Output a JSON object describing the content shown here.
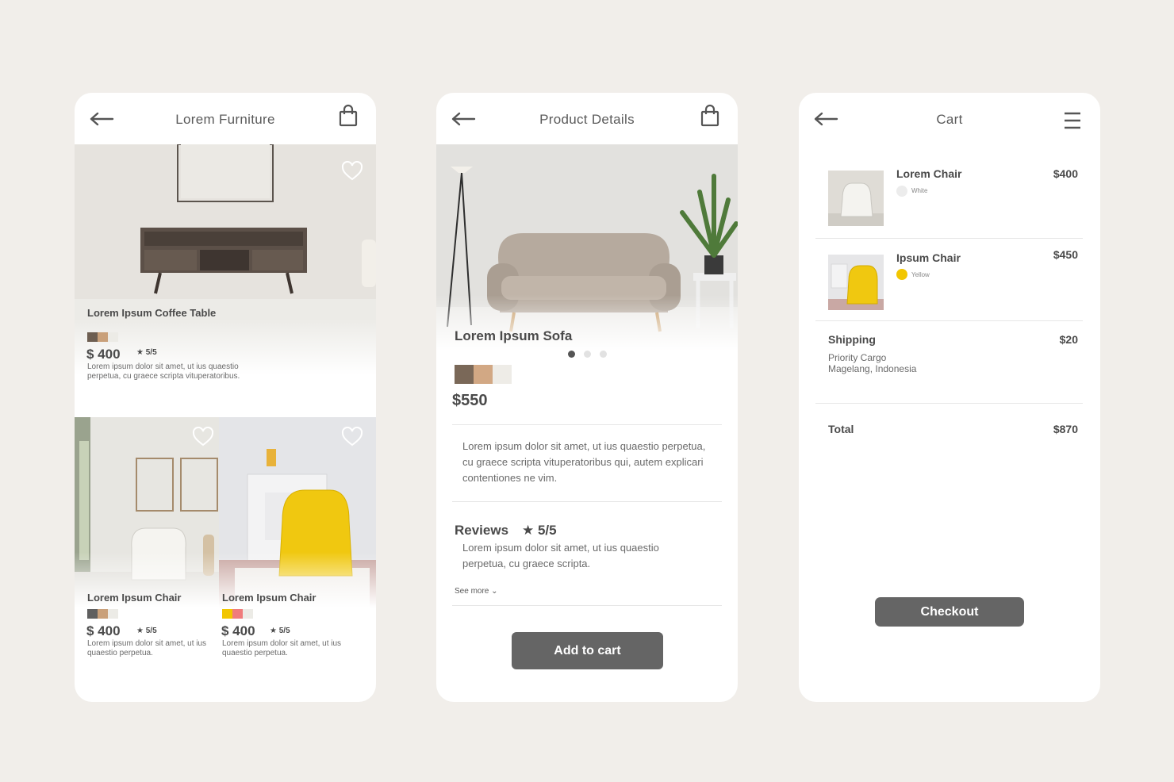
{
  "screen1": {
    "title": "Lorem Furniture",
    "featured": {
      "name": "Lorem Ipsum Coffee Table",
      "swatches": [
        "#6d5e51",
        "#c9a07a",
        "#ecebe6"
      ],
      "price": "$ 400",
      "rating": "★ 5/5",
      "description": "Lorem ipsum dolor sit amet, ut ius quaestio perpetua, cu graece scripta vituperatoribus."
    },
    "products": [
      {
        "name": "Lorem Ipsum Chair",
        "swatches": [
          "#5f5f5f",
          "#c9a07a",
          "#ecebe6"
        ],
        "price": "$ 400",
        "rating": "★ 5/5",
        "description": "Lorem ipsum dolor sit amet, ut ius quaestio perpetua."
      },
      {
        "name": "Lorem Ipsum Chair",
        "swatches": [
          "#f2c600",
          "#f07c7c",
          "#ecebe6"
        ],
        "price": "$ 400",
        "rating": "★ 5/5",
        "description": "Lorem ipsum dolor sit amet, ut ius quaestio perpetua."
      }
    ]
  },
  "screen2": {
    "title": "Product Details",
    "product_name": "Lorem Ipsum Sofa",
    "swatches": [
      "#7a6858",
      "#d2a884",
      "#eeece7"
    ],
    "price": "$550",
    "description": "Lorem ipsum dolor sit amet, ut ius quaestio perpetua, cu graece scripta vituperatoribus qui, autem explicari contentiones ne vim.",
    "reviews_heading": "Reviews",
    "reviews_rating": "★ 5/5",
    "review_text": "Lorem ipsum dolor sit amet, ut ius quaestio perpetua, cu graece scripta.",
    "see_more": "See more ⌄",
    "add_to_cart": "Add to cart",
    "carousel_active_index": 0
  },
  "screen3": {
    "title": "Cart",
    "items": [
      {
        "name": "Lorem Chair",
        "color_label": "White",
        "color": "#ececec",
        "price": "$400"
      },
      {
        "name": "Ipsum Chair",
        "color_label": "Yellow",
        "color": "#f2c600",
        "price": "$450"
      }
    ],
    "shipping_label": "Shipping",
    "shipping_method": "Priority Cargo",
    "shipping_location": "Magelang, Indonesia",
    "shipping_price": "$20",
    "total_label": "Total",
    "total_price": "$870",
    "checkout": "Checkout"
  },
  "colors": {
    "background": "#f1eeea",
    "button": "#656565",
    "text": "#4a4a4a"
  }
}
